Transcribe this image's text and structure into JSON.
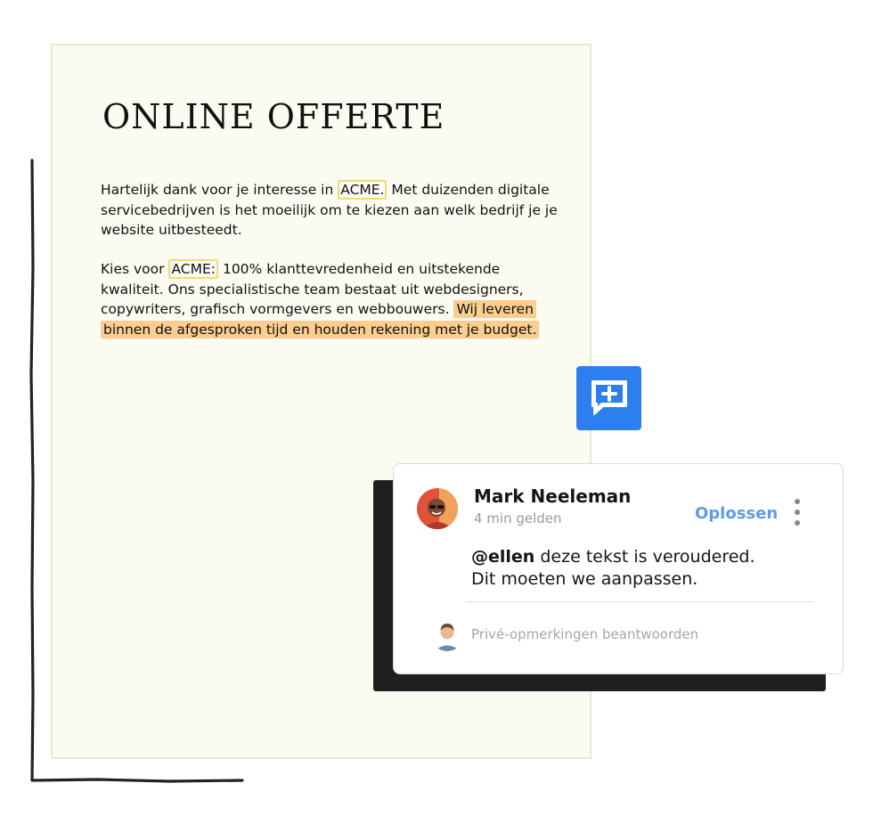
{
  "document": {
    "title": "ONLINE OFFERTE",
    "paragraph1": {
      "before": "Hartelijk dank voor je interesse in",
      "tag": "ACME.",
      "after": "Met duizenden digitale servicebedrijven is het moeilijk om te kiezen aan welk bedrijf je je website uitbesteedt."
    },
    "paragraph2": {
      "before": "Kies voor",
      "tag": "ACME:",
      "after": "100% klanttevredenheid en uitstekende kwaliteit. Ons specialistische team bestaat uit webdesigners, copywriters, grafisch vormgevers en webbouwers.",
      "highlighted": "Wij leveren binnen de afgesproken tijd en houden rekening met je budget."
    }
  },
  "add_comment_button": {
    "icon": "add-comment-icon",
    "color": "#2d7ff0"
  },
  "comment": {
    "author": "Mark Neeleman",
    "time": "4 min gelden",
    "resolve_label": "Oplossen",
    "mention": "@ellen",
    "text_line1": "deze tekst is veroudered.",
    "text_line2": "Dit moeten we aanpassen.",
    "reply_placeholder": "Privé-opmerkingen beantwoorden"
  },
  "colors": {
    "accent": "#5b9be8",
    "highlight": "#fbcd8f",
    "tag_border": "#f2d978",
    "page_background": "#fcfbf2"
  }
}
